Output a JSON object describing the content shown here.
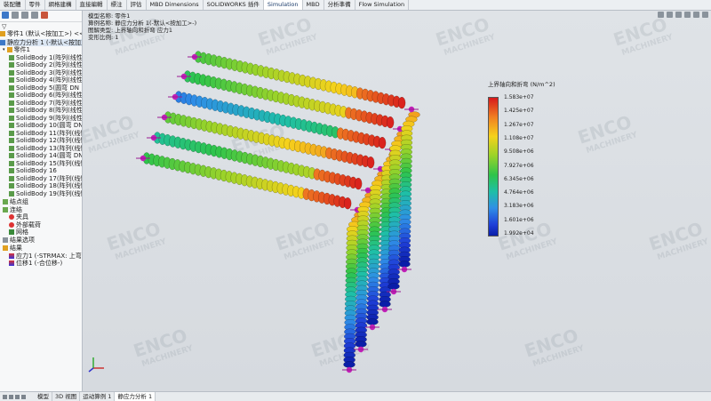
{
  "top_tabs": [
    "裝配體",
    "零件",
    "網格建構",
    "直接編輯",
    "標注",
    "評估",
    "MBD Dimensions",
    "SOLIDWORKS 插件",
    "Simulation",
    "MBD",
    "分析準備",
    "Flow Simulation"
  ],
  "active_top_tab": 8,
  "tree": {
    "root": "零件1 (默认<按加工>) <<默",
    "study": "静应力分析 1 (-默认<按加工>-)",
    "part": "零件1",
    "bodies": [
      "SolidBody 1(阵列(线性)",
      "SolidBody 2(阵列(线性)",
      "SolidBody 3(阵列(线性)",
      "SolidBody 4(阵列(线性)",
      "SolidBody 5(圆弯 DN",
      "SolidBody 6(阵列(线性)",
      "SolidBody 7(阵列(线性)",
      "SolidBody 8(阵列(线性)",
      "SolidBody 9(阵列(线性)",
      "SolidBody 10(圆弯 DN4",
      "SolidBody 11(阵列(线性)",
      "SolidBody 12(阵列(线性)",
      "SolidBody 13(阵列(线性)",
      "SolidBody 14(圆弯 DN4",
      "SolidBody 15(阵列(线性)",
      "SolidBody 16",
      "SolidBody 17(阵列(线性)",
      "SolidBody 18(阵列(线性)",
      "SolidBody 19(阵列(线性)"
    ],
    "connections": "结点组",
    "fixtures": "连结",
    "fixture_items": [
      "夹具",
      "外部载荷",
      "网格"
    ],
    "result_options": "结果选项",
    "results": "结果",
    "result_items": [
      "应力1 (-STRMAX: 上弯曲)",
      "位移1 (-合位移-)"
    ]
  },
  "viewport_info": [
    "模型名称: 零件1",
    "算例名称: 静应力分析 1(-默认<按加工>-)",
    "图解类型: 上界轴向和折弯 应力1",
    "变形比例: 1"
  ],
  "legend": {
    "title": "上界轴向和折弯 (N/m^2)",
    "ticks": [
      "1.583e+07",
      "1.425e+07",
      "1.267e+07",
      "1.108e+07",
      "9.508e+06",
      "7.927e+06",
      "6.345e+06",
      "4.764e+06",
      "3.183e+06",
      "1.601e+06",
      "1.992e+04"
    ]
  },
  "watermark": {
    "line1": "ENCO",
    "line2": "MACHINERY"
  },
  "bottom_tabs": [
    "模型",
    "3D 视图",
    "运动算例 1",
    "静应力分析 1"
  ],
  "active_bottom_tab": 3,
  "colors": {
    "accent": "#1b3c6b",
    "pipe_top": "#d7191c",
    "pipe_bottom": "#0a1ea8"
  }
}
